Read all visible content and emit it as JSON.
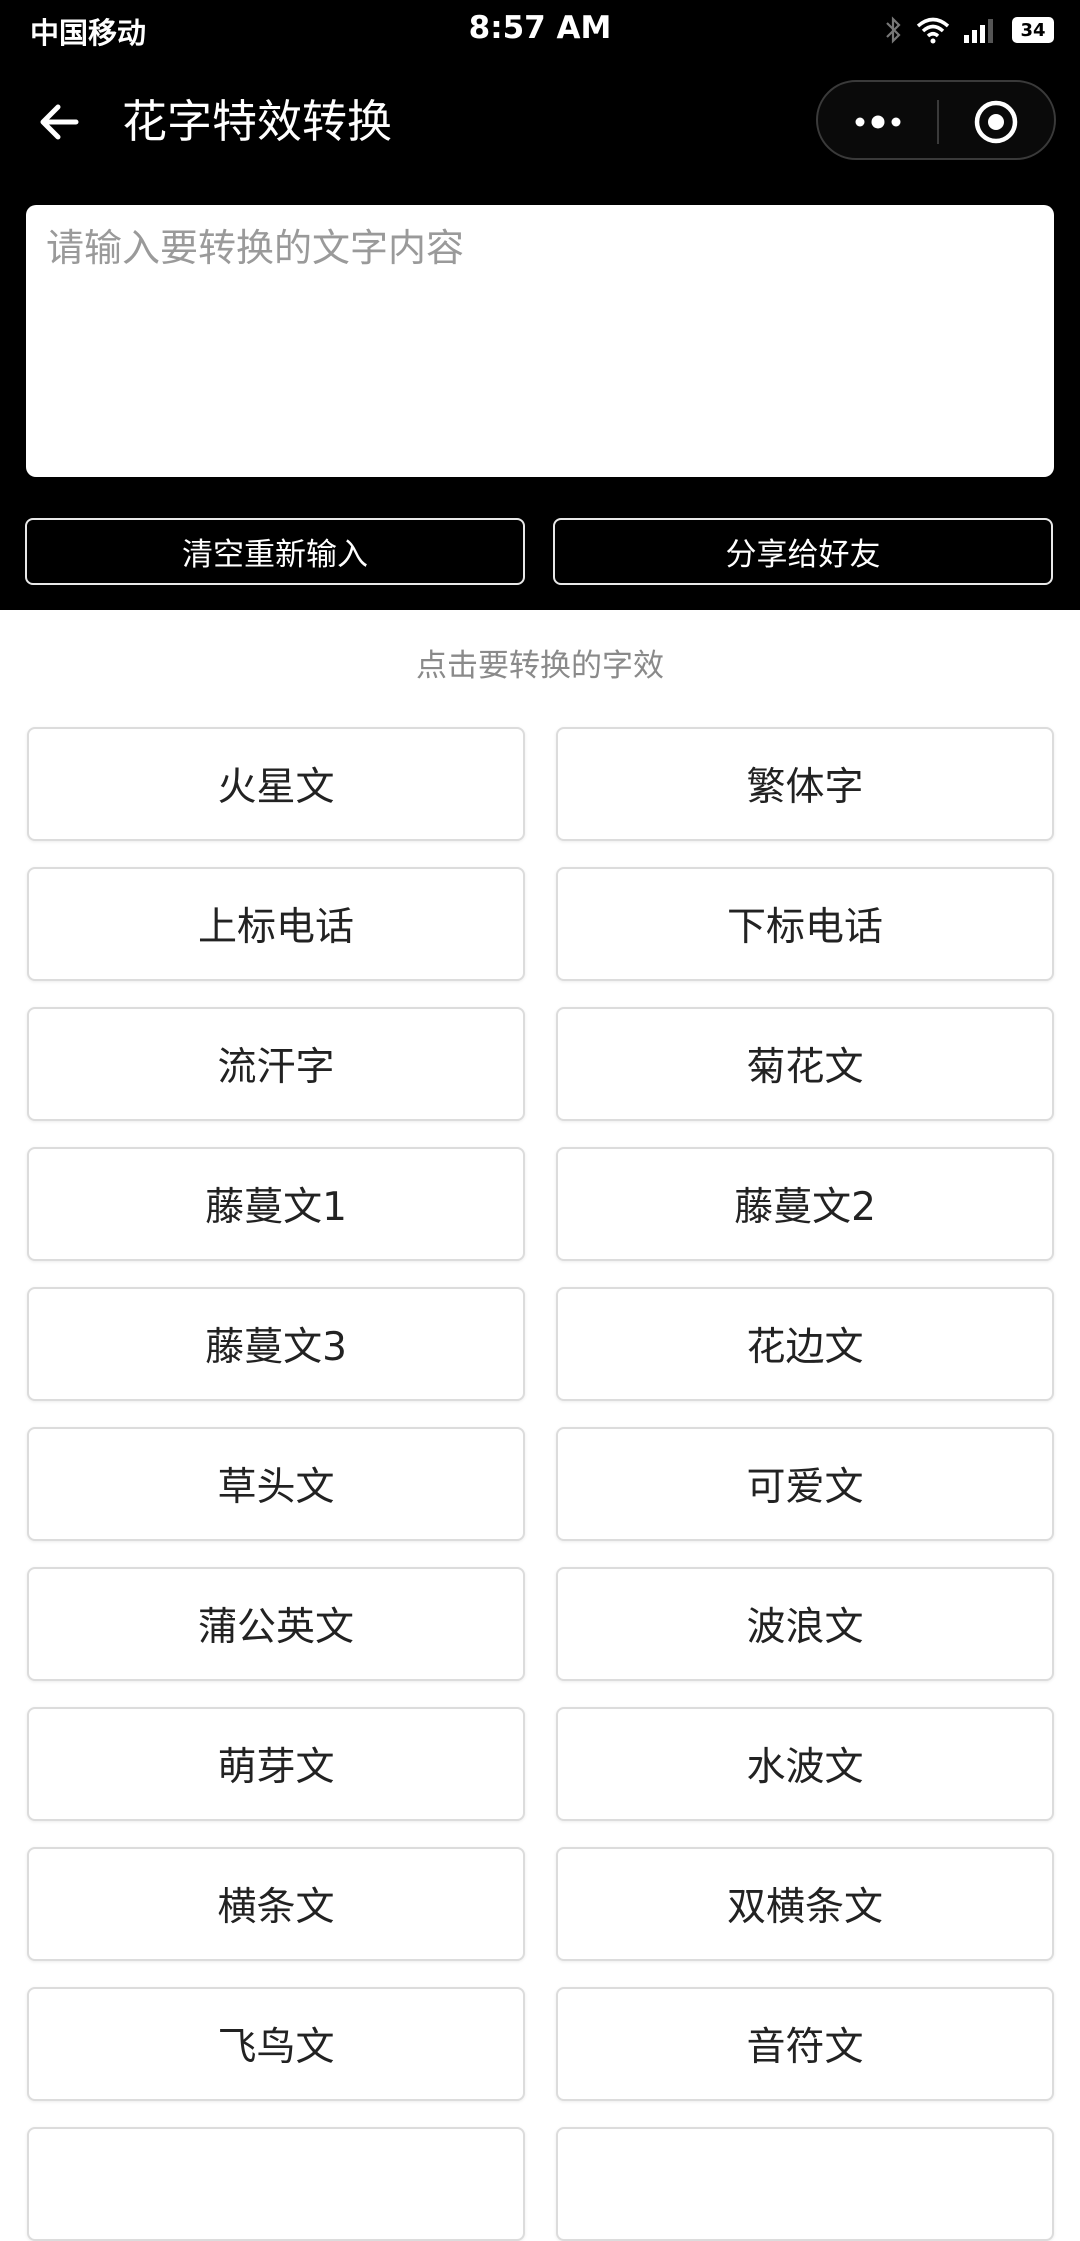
{
  "status_bar": {
    "carrier": "中国移动",
    "time": "8:57 AM",
    "battery": "34"
  },
  "nav": {
    "title": "花字特效转换",
    "icons": [
      "back-arrow-icon",
      "more-dots-icon",
      "target-icon"
    ]
  },
  "input": {
    "placeholder": "请输入要转换的文字内容",
    "value": ""
  },
  "actions": {
    "clear_label": "清空重新输入",
    "share_label": "分享给好友"
  },
  "hint": "点击要转换的字效",
  "effects": [
    "火星文",
    "繁体字",
    "上标电话",
    "下标电话",
    "流汗字",
    "菊花文",
    "藤蔓文1",
    "藤蔓文2",
    "藤蔓文3",
    "花边文",
    "草头文",
    "可爱文",
    "蒲公英文",
    "波浪文",
    "萌芽文",
    "水波文",
    "横条文",
    "双横条文",
    "飞鸟文",
    "音符文",
    "",
    ""
  ],
  "colors": {
    "header_bg": "#000000",
    "page_bg": "#ffffff",
    "hint_text": "#8a8a8a",
    "button_border": "#dcdcdc"
  }
}
